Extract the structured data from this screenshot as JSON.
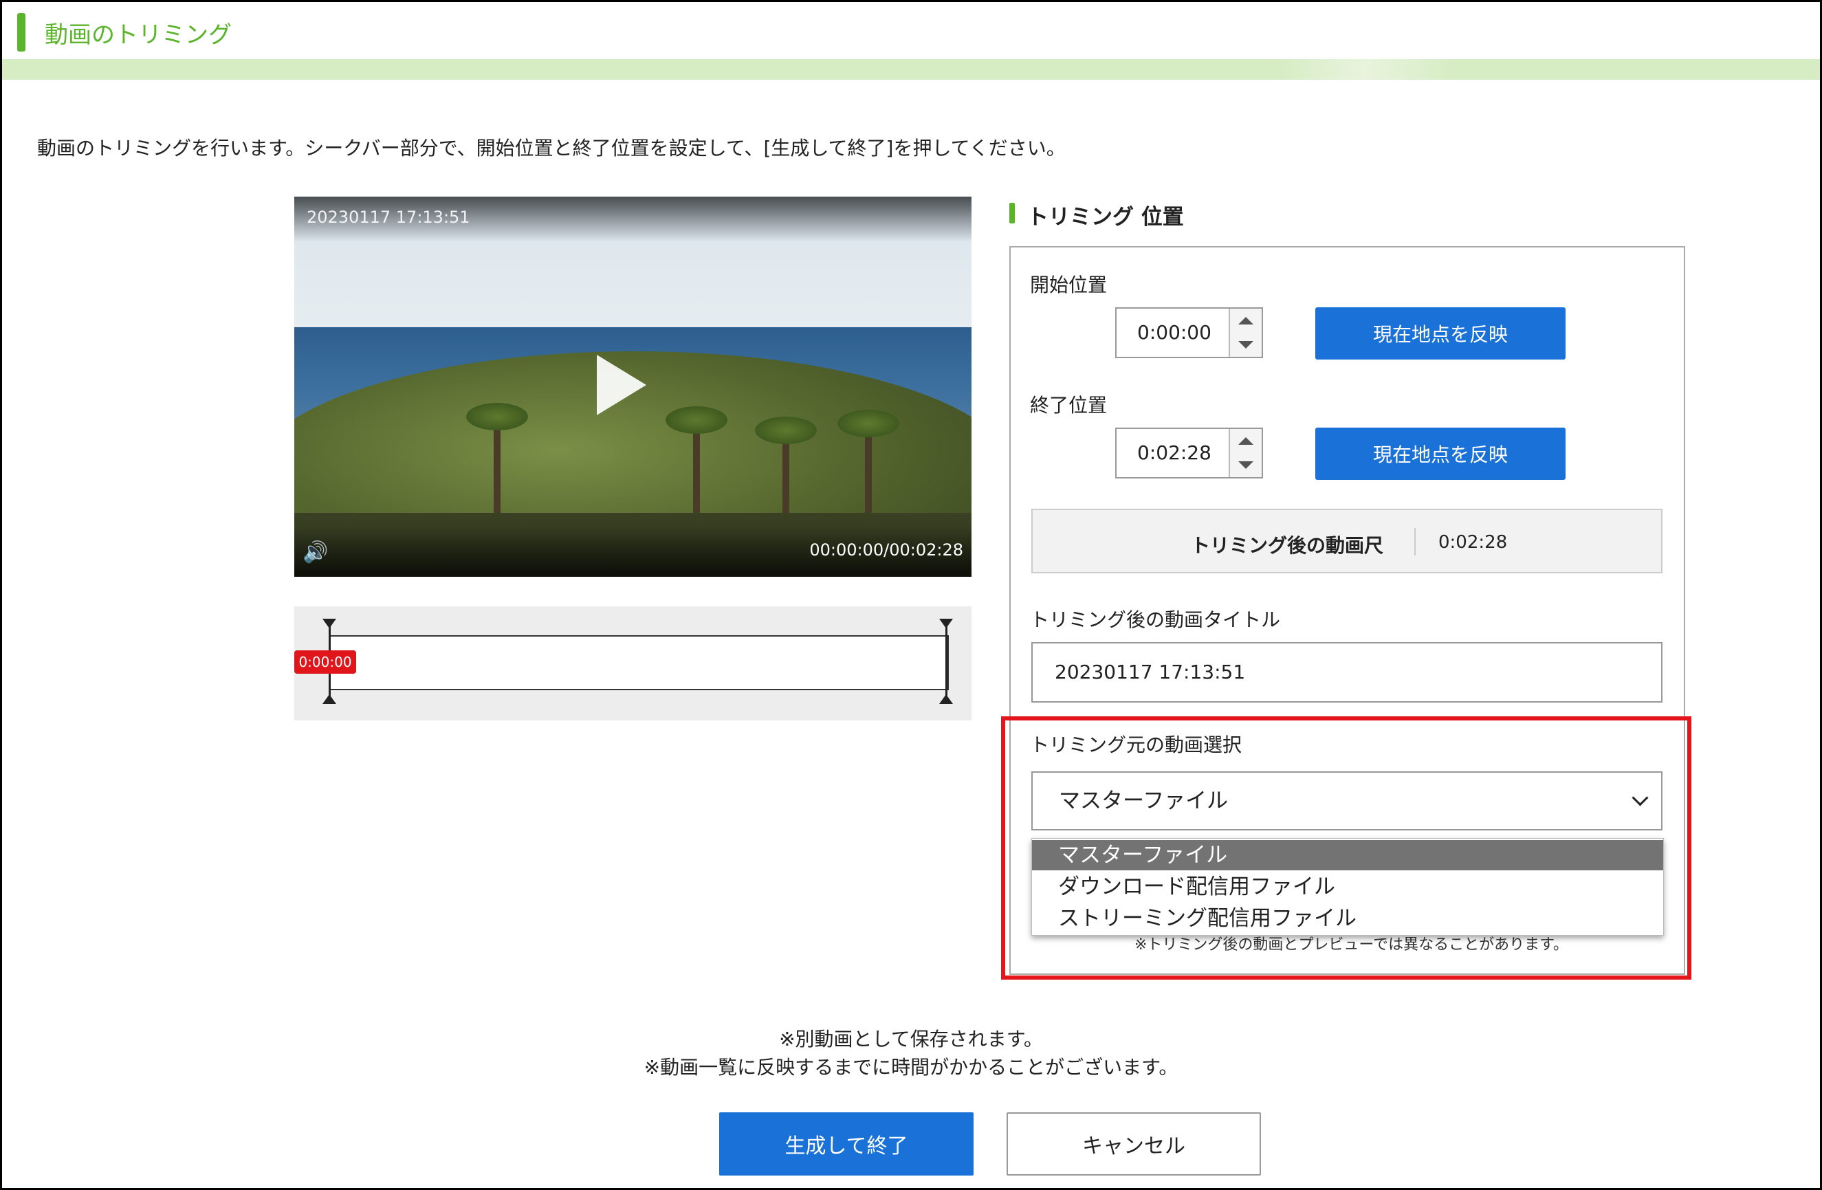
{
  "header": {
    "title": "動画のトリミング"
  },
  "description": "動画のトリミングを行います。シークバー部分で、開始位置と終了位置を設定して、[生成して終了]を押してください。",
  "player": {
    "video_title": "20230117 17:13:51",
    "time_display": "00:00:00/00:02:28",
    "volume_icon": "speaker-icon",
    "play_icon": "play-icon"
  },
  "seekbar": {
    "current_label": "0:00:00",
    "start_fraction": 0,
    "end_fraction": 1
  },
  "trimming": {
    "section_title": "トリミング 位置",
    "start_label": "開始位置",
    "start_value": "0:00:00",
    "end_label": "終了位置",
    "end_value": "0:02:28",
    "reflect_button": "現在地点を反映",
    "duration_label": "トリミング後の動画尺",
    "duration_value": "0:02:28",
    "title_label": "トリミング後の動画タイトル",
    "title_value": "20230117 17:13:51",
    "source_label": "トリミング元の動画選択",
    "source_selected": "マスターファイル",
    "source_options": [
      "マスターファイル",
      "ダウンロード配信用ファイル",
      "ストリーミング配信用ファイル"
    ],
    "preview_note": "※トリミング後の動画とプレビューでは異なることがあります。"
  },
  "footer": {
    "note1": "※別動画として保存されます。",
    "note2": "※動画一覧に反映するまでに時間がかかることがございます。",
    "generate_button": "生成して終了",
    "cancel_button": "キャンセル"
  },
  "colors": {
    "accent_green": "#5ab52b",
    "primary_blue": "#1a72d8",
    "highlight_red": "#e2161b",
    "seek_marker": "#e0161c"
  }
}
